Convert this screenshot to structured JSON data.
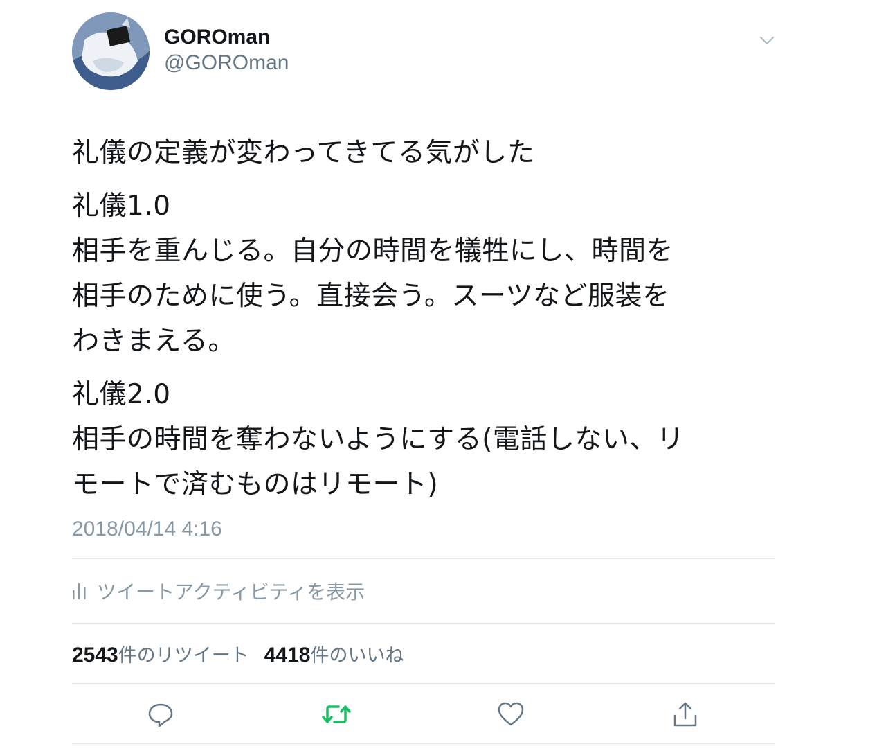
{
  "tweet": {
    "display_name": "GOROman",
    "handle": "@GOROman",
    "text": {
      "line1": "礼儀の定義が変わってきてる気がした",
      "para2": "礼儀1.0\n相手を重んじる。自分の時間を犠牲にし、時間を\n相手のために使う。直接会う。スーツなど服装を\nわきまえる。",
      "para3": "礼儀2.0\n相手の時間を奪わないようにする(電話しない、リ\nモートで済むものはリモート)"
    },
    "timestamp": "2018/04/14 4:16",
    "activity_label": "ツイートアクティビティを表示",
    "retweet_count": "2543",
    "retweet_label": "件のリツイート",
    "like_count": "4418",
    "like_label": "件のいいね"
  },
  "icons": {
    "menu": "chevron-down-icon",
    "activity": "bar-chart-icon",
    "reply": "reply-icon",
    "retweet": "retweet-icon",
    "like": "heart-icon",
    "share": "share-icon"
  },
  "colors": {
    "text": "#14171a",
    "secondary": "#657786",
    "muted": "#8899a6",
    "retweet_green": "#17bf63",
    "divider": "#e1e8ed"
  }
}
